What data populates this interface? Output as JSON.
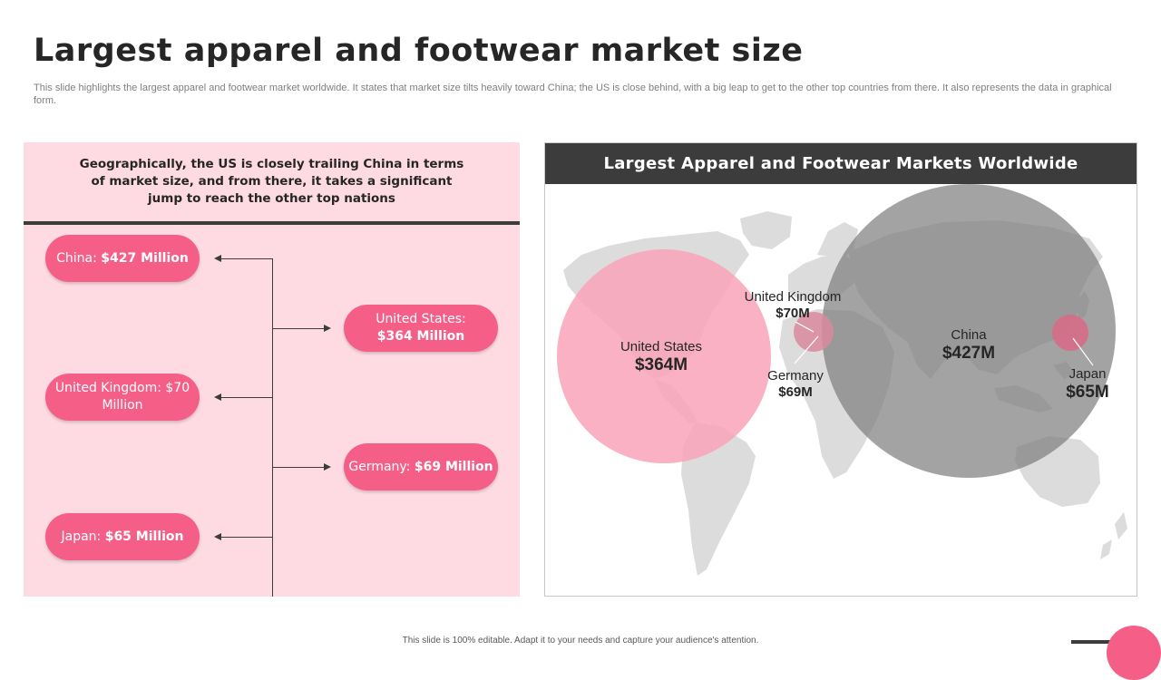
{
  "title": "Largest apparel and footwear market size",
  "subtitle": "This slide highlights the largest apparel and footwear market worldwide. It states that market size tilts heavily toward China; the US is close behind, with a big leap to get to the other top countries from there. It also represents the data in graphical form.",
  "left_panel": {
    "header": "Geographically, the US is closely trailing China in terms of market size, and from there, it takes a significant jump to reach the other top nations",
    "items": [
      {
        "label": "China:",
        "value": "$427 Million"
      },
      {
        "label": "United States:",
        "value": "$364 Million"
      },
      {
        "label": "United Kingdom: $70",
        "value": "Million"
      },
      {
        "label": "Germany:",
        "value": "$69 Million"
      },
      {
        "label": "Japan:",
        "value": "$65 Million"
      }
    ]
  },
  "map": {
    "title": "Largest Apparel and Footwear Markets Worldwide",
    "markets": [
      {
        "name": "United States",
        "value": "$364M",
        "color": "#f8a3b8"
      },
      {
        "name": "United Kingdom",
        "value": "$70M",
        "color": "#d98a9c"
      },
      {
        "name": "Germany",
        "value": "$69M",
        "color": "#d98a9c"
      },
      {
        "name": "China",
        "value": "$427M",
        "color": "#808080"
      },
      {
        "name": "Japan",
        "value": "$65M",
        "color": "#d96a86"
      }
    ]
  },
  "footer": "This slide is 100% editable.  Adapt it to your needs and capture your audience's attention.",
  "colors": {
    "accent": "#f55f87",
    "panel_bg": "#fedbe3",
    "dark": "#3c3c3c"
  }
}
